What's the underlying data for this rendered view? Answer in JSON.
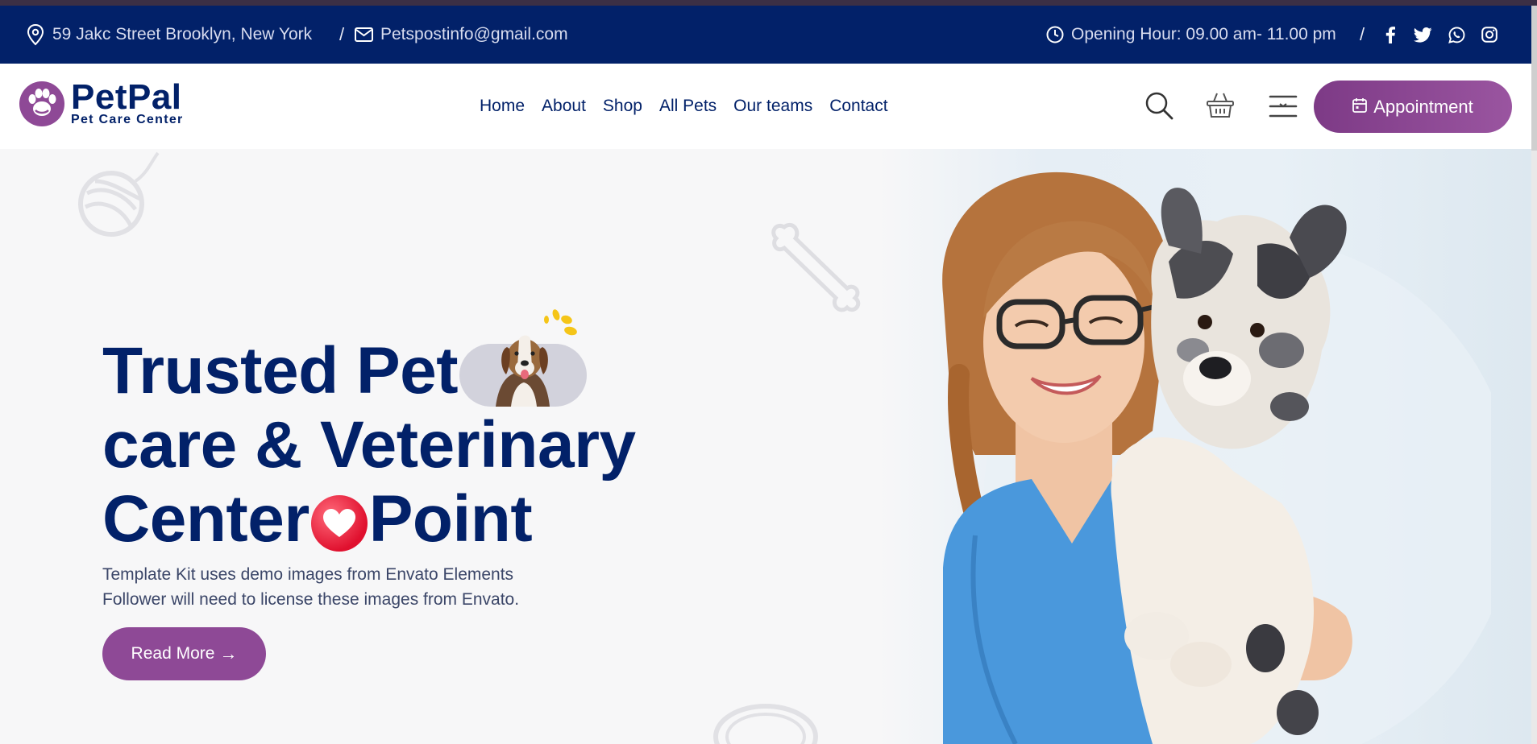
{
  "topbar": {
    "address": "59 Jakc Street Brooklyn, New York",
    "separator": "/",
    "email": "Petspostinfo@gmail.com",
    "hours": "Opening Hour: 09.00 am- 11.00 pm",
    "hours_separator": "/",
    "social_icons": [
      "facebook-icon",
      "twitter-icon",
      "whatsapp-icon",
      "instagram-icon"
    ]
  },
  "brand": {
    "name": "PetPal",
    "tagline": "Pet Care Center"
  },
  "nav": {
    "items": [
      "Home",
      "About",
      "Shop",
      "All Pets",
      "Our teams",
      "Contact"
    ],
    "appointment_label": "Appointment"
  },
  "hero": {
    "line1": "Trusted Pet",
    "line2": "care & Veterinary",
    "line3_a": "Center",
    "line3_b": "Point",
    "description_1": "Template Kit uses demo images from Envato Elements",
    "description_2": "Follower will need to license these images from Envato.",
    "cta_label": "Read More",
    "cta_arrow": "→"
  },
  "colors": {
    "navy": "#022169",
    "purple": "#8e4996",
    "heart": "#e0102e",
    "accent_yellow": "#f5c518"
  }
}
